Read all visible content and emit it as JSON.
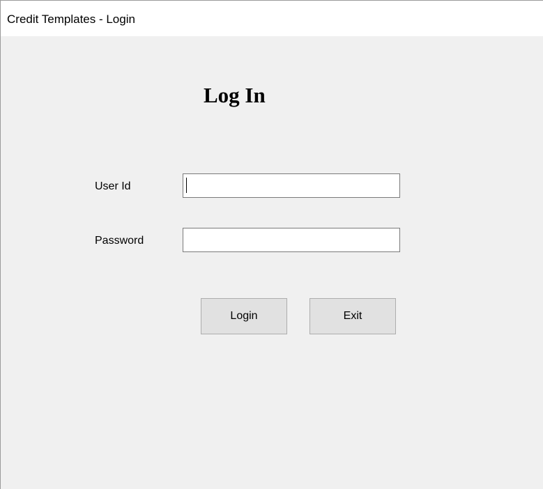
{
  "window": {
    "title": "Credit Templates - Login"
  },
  "form": {
    "heading": "Log In",
    "user_id_label": "User Id",
    "user_id_value": "",
    "password_label": "Password",
    "password_value": ""
  },
  "buttons": {
    "login_label": "Login",
    "exit_label": "Exit"
  }
}
